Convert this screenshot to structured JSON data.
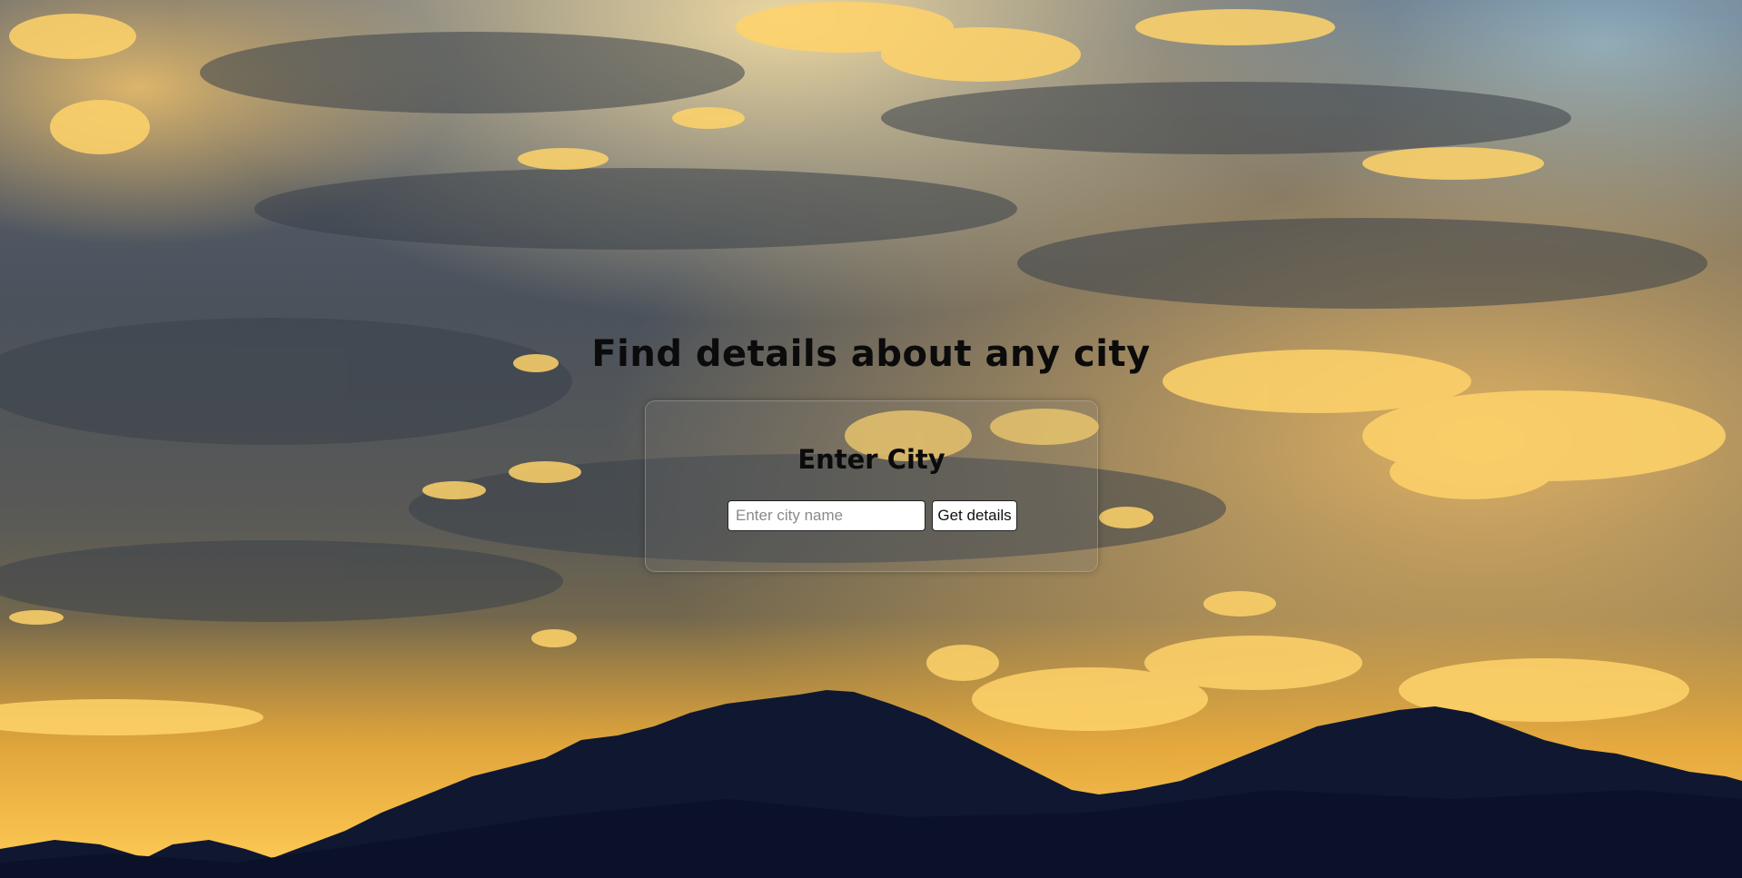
{
  "page": {
    "title": "Find details about any city",
    "background": "sunset sky with clouds over mountain silhouette"
  },
  "search_card": {
    "heading": "Enter City",
    "input_placeholder": "Enter city name",
    "input_value": "",
    "button_label": "Get details"
  },
  "colors": {
    "text": "#0b0b0b",
    "mountain": "#0f1830",
    "sky_gold": "#f4b03a",
    "cloud_gray": "#4a525e"
  }
}
